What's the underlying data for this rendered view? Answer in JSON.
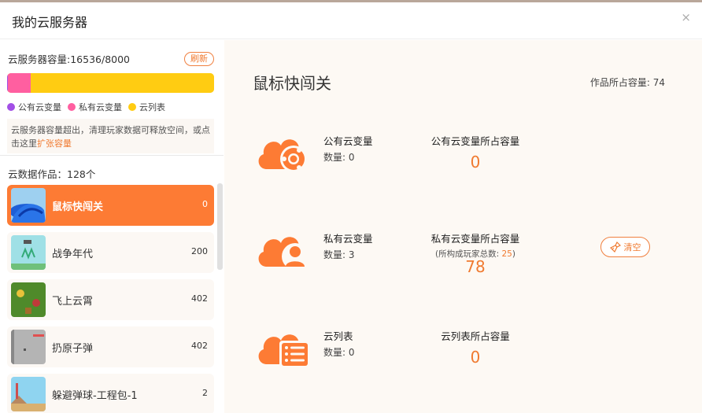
{
  "dialog": {
    "title": "我的云服务器",
    "close": "×"
  },
  "sidebar": {
    "capacity_label": "云服务器容量:16536/8000",
    "refresh_label": "刷新",
    "usage": [
      {
        "name": "公有云变量",
        "color": "#a24fe6",
        "fraction": 0.004
      },
      {
        "name": "私有云变量",
        "color": "#ff5fa0",
        "fraction": 0.11
      },
      {
        "name": "云列表",
        "color": "#ffcc12",
        "fraction": 0.886
      }
    ],
    "notice_text": "云服务器容量超出，清理玩家数据可释放空间，或点击这里",
    "notice_link": "扩张容量",
    "works_count": "云数据作品：128个",
    "works": [
      {
        "name": "鼠标快闯关",
        "value": "0"
      },
      {
        "name": "战争年代",
        "value": "200"
      },
      {
        "name": "飞上云霄",
        "value": "402"
      },
      {
        "name": "扔原子弹",
        "value": "402"
      },
      {
        "name": "躲避弹球-工程包-1",
        "value": "2"
      }
    ]
  },
  "main": {
    "work_title": "鼠标快闯关",
    "work_capacity": "作品所占容量: 74",
    "sections": {
      "public": {
        "title": "公有云变量",
        "count": "数量: 0",
        "cap_label": "公有云变量所占容量",
        "cap_value": "0"
      },
      "private": {
        "title": "私有云变量",
        "count": "数量: 3",
        "cap_label": "私有云变量所占容量",
        "cap_sub_prefix": "(所构成玩家总数: ",
        "cap_sub_num": "25",
        "cap_sub_suffix": ")",
        "cap_value": "78",
        "clear_label": "清空"
      },
      "list": {
        "title": "云列表",
        "count": "数量: 0",
        "cap_label": "云列表所占容量",
        "cap_value": "0"
      }
    }
  }
}
